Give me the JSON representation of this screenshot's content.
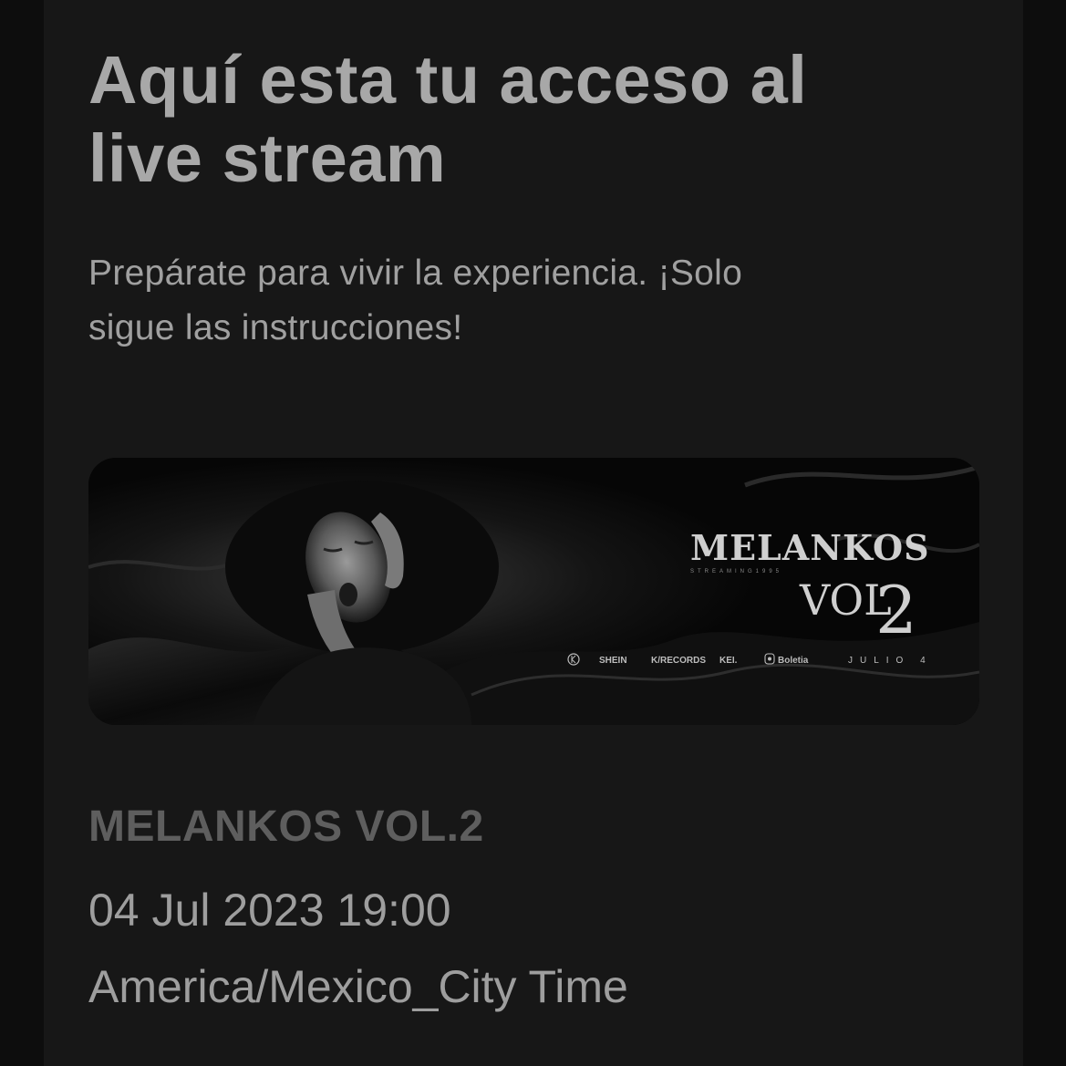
{
  "header": {
    "title_line1": "Aquí esta tu acceso al",
    "title_line2": "live stream",
    "subtitle_line1": "Prepárate para vivir la experiencia. ¡Solo",
    "subtitle_line2": "sigue las instrucciones!"
  },
  "banner": {
    "logo_main": "MELANKOS",
    "logo_tag": "STREAMING1995",
    "logo_vol": "VOL",
    "logo_num": "2",
    "sponsors": [
      "SHEIN",
      "K/RECORDS",
      "KEI.",
      "Boletia"
    ],
    "date_text": "JULIO 4",
    "icons": [
      "k-circle-icon",
      "boletia-icon"
    ]
  },
  "event": {
    "name": "MELANKOS VOL.2",
    "datetime": "04 Jul 2023 19:00",
    "timezone": "America/Mexico_City Time"
  },
  "colors": {
    "page_background": "#0d0d0d",
    "card_background": "#171717",
    "title_text": "#a8a8a8",
    "event_name_text": "#5e5e5e"
  }
}
